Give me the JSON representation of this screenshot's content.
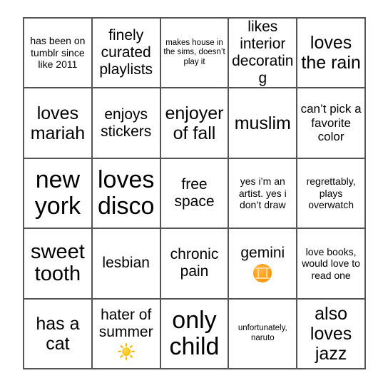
{
  "card": {
    "title": "bingo card",
    "grid_size": 5,
    "border_color": "#555555",
    "background_color": "#ffffff",
    "text_color": "#000000",
    "cells": [
      {
        "text": "has been on tumblr since like 2011",
        "size": "s-xs",
        "emoji": null,
        "free": false
      },
      {
        "text": "finely curated playlists",
        "size": "s-md",
        "emoji": null,
        "free": false
      },
      {
        "text": "makes house in the sims, doesn’t play it",
        "size": "s-xxs",
        "emoji": null,
        "free": false
      },
      {
        "text": "likes interior decorating",
        "size": "s-md",
        "emoji": null,
        "free": false
      },
      {
        "text": "loves the rain",
        "size": "s-lg",
        "emoji": null,
        "free": false
      },
      {
        "text": "loves mariah",
        "size": "s-lg",
        "emoji": null,
        "free": false
      },
      {
        "text": "enjoys stickers",
        "size": "s-md",
        "emoji": null,
        "free": false
      },
      {
        "text": "enjoyer of fall",
        "size": "s-lg",
        "emoji": null,
        "free": false
      },
      {
        "text": "muslim",
        "size": "s-lg",
        "emoji": null,
        "free": false
      },
      {
        "text": "can’t pick a favorite color",
        "size": "s-sm",
        "emoji": null,
        "free": false
      },
      {
        "text": "new york",
        "size": "s-xxl",
        "emoji": null,
        "free": false
      },
      {
        "text": "loves disco",
        "size": "s-xxl",
        "emoji": null,
        "free": false
      },
      {
        "text": "free space",
        "size": "s-md",
        "emoji": null,
        "free": true
      },
      {
        "text": "yes i’m an artist. yes i don’t draw",
        "size": "s-xs",
        "emoji": null,
        "free": false
      },
      {
        "text": "regrettably, plays overwatch",
        "size": "s-xs",
        "emoji": null,
        "free": false
      },
      {
        "text": "sweet tooth",
        "size": "s-xl",
        "emoji": null,
        "free": false
      },
      {
        "text": "lesbian",
        "size": "s-md",
        "emoji": null,
        "free": false
      },
      {
        "text": "chronic pain",
        "size": "s-md",
        "emoji": null,
        "free": false
      },
      {
        "text": "gemini",
        "size": "s-md",
        "emoji": "gemini-zodiac-emoji",
        "free": false
      },
      {
        "text": "love books, would love to read one",
        "size": "s-xs",
        "emoji": null,
        "free": false
      },
      {
        "text": "has a cat",
        "size": "s-lg",
        "emoji": null,
        "free": false
      },
      {
        "text": "hater of summer",
        "size": "s-md",
        "emoji": "sun-emoji",
        "free": false
      },
      {
        "text": "only child",
        "size": "s-xxl",
        "emoji": null,
        "free": false
      },
      {
        "text": "unfortunately, naruto",
        "size": "s-xxs",
        "emoji": null,
        "free": false
      },
      {
        "text": "also loves jazz",
        "size": "s-lg",
        "emoji": null,
        "free": false
      }
    ]
  }
}
